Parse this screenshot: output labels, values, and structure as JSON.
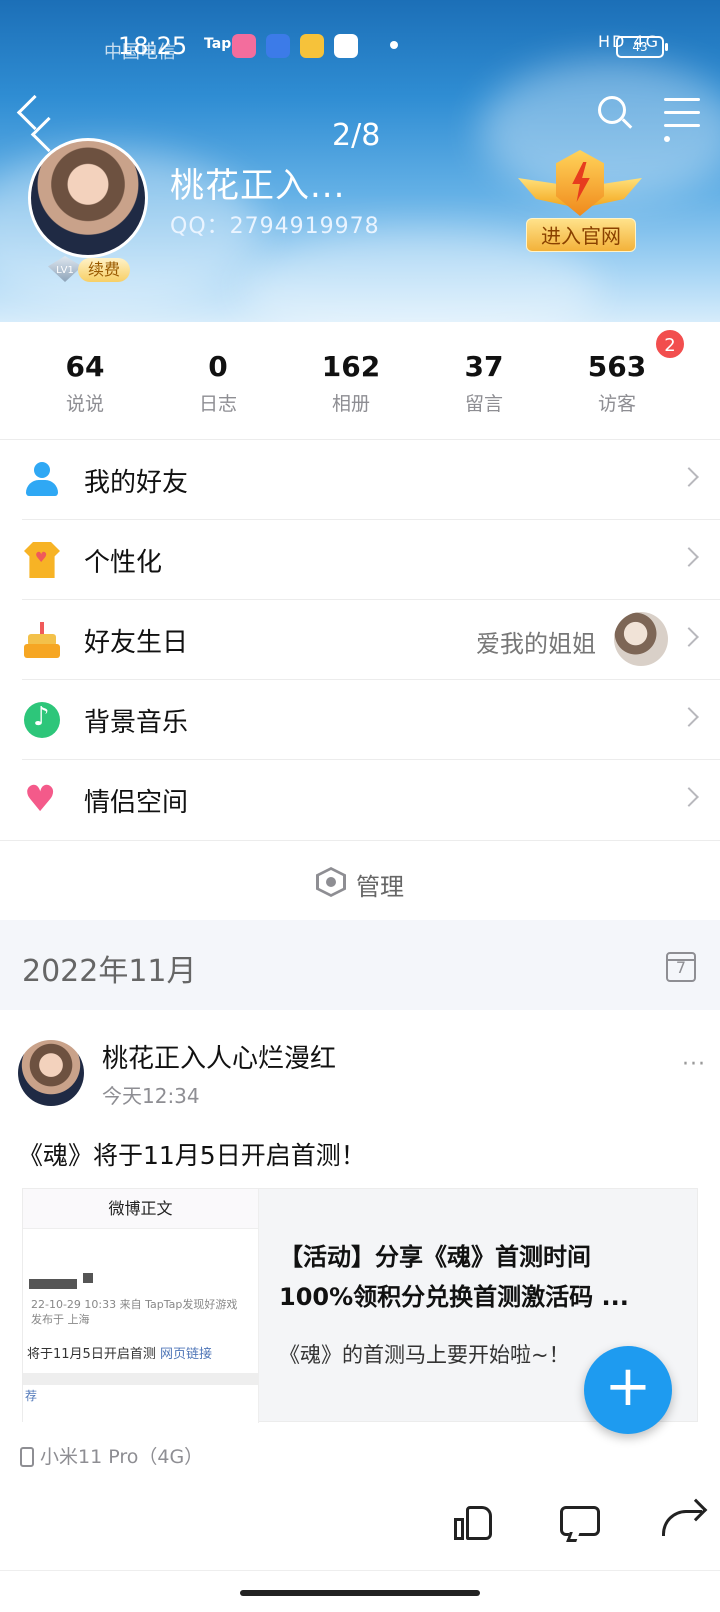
{
  "status_bar": {
    "time": "18:25",
    "carrier": "中国电信",
    "app_label": "Tap",
    "network": "HD 4G",
    "battery": "43",
    "app_icons": [
      "bilibili-icon",
      "infinity-icon",
      "ticket-icon",
      "feather-icon"
    ]
  },
  "header": {
    "page_counter": "2/8",
    "nickname": "桃花正入...",
    "qq_line": "QQ：2794919978",
    "level": "LV1",
    "renew_label": "续费",
    "official_button": "进入官网"
  },
  "stats": [
    {
      "value": "64",
      "label": "说说"
    },
    {
      "value": "0",
      "label": "日志"
    },
    {
      "value": "162",
      "label": "相册"
    },
    {
      "value": "37",
      "label": "留言"
    },
    {
      "value": "563",
      "label": "访客",
      "badge": "2"
    }
  ],
  "menu": [
    {
      "label": "我的好友",
      "icon": "friends-icon"
    },
    {
      "label": "个性化",
      "icon": "shirt-icon"
    },
    {
      "label": "好友生日",
      "icon": "cake-icon",
      "extra": "爱我的姐姐"
    },
    {
      "label": "背景音乐",
      "icon": "music-icon"
    },
    {
      "label": "情侣空间",
      "icon": "heart-icon"
    }
  ],
  "manage_label": "管理",
  "date_section": {
    "title": "2022年11月",
    "calendar_day": "7"
  },
  "post": {
    "author": "桃花正入人心烂漫红",
    "time": "今天12:34",
    "more": "···",
    "content": "《魂》将于11月5日开启首测！",
    "link_card": {
      "thumb_header": "微博正文",
      "thumb_meta_1": "22-10-29 10:33  来自 TapTap发现好游戏",
      "thumb_meta_2": "发布于 上海",
      "thumb_text": "将于11月5日开启首测",
      "thumb_link": "网页链接",
      "thumb_rec": "荐",
      "title_1": "【活动】分享《魂》首测时间",
      "title_2": "100%领积分兑换首测激活码 ...",
      "description": "《魂》的首测马上要开始啦~！"
    },
    "device": "小米11 Pro（4G）"
  },
  "fab_label": "+"
}
